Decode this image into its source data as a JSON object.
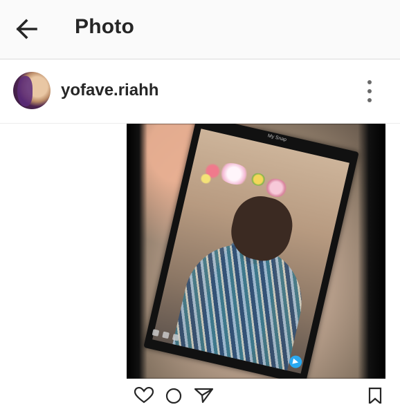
{
  "appbar": {
    "title": "Photo",
    "back_icon": "arrow-left-icon"
  },
  "post": {
    "username": "yofave.riahh",
    "avatar_icon": "avatar",
    "more_icon": "more-vertical-icon",
    "image": {
      "description_icon": "photo",
      "snap_header": "My Snap"
    }
  },
  "actions": {
    "like_icon": "heart-icon",
    "comment_icon": "comment-icon",
    "share_icon": "send-icon",
    "save_icon": "bookmark-icon"
  },
  "colors": {
    "appbar_bg": "#fafafa",
    "text": "#262626",
    "divider": "#dbdbdb",
    "snap_send": "#2aa9f0"
  }
}
